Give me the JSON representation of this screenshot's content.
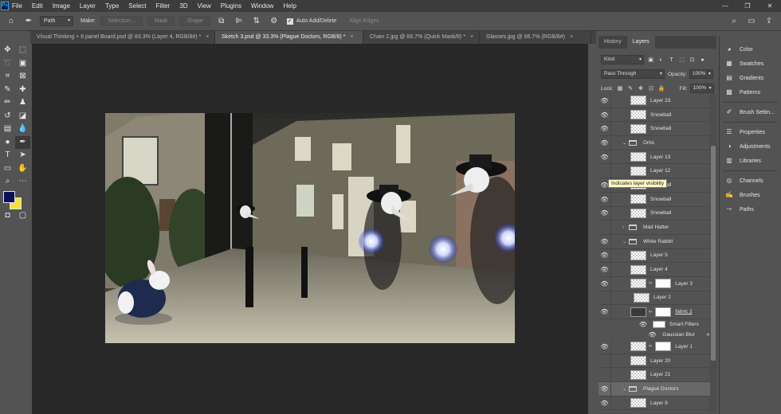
{
  "menu": [
    "File",
    "Edit",
    "Image",
    "Layer",
    "Type",
    "Select",
    "Filter",
    "3D",
    "View",
    "Plugins",
    "Window",
    "Help"
  ],
  "logo": "Ps",
  "window_controls": [
    "—",
    "❐",
    "✕"
  ],
  "options_bar": {
    "mode": "Path",
    "make_label": "Make:",
    "selection_btn": "Selection...",
    "mask_btn": "Mask",
    "shape_btn": "Shape",
    "auto_add_delete": "Auto Add/Delete",
    "align_edges": "Align Edges"
  },
  "tabs": [
    "Visual Thinking + 6 panel Board.psd @ 83.3% (Layer 4, RGB/8#) *",
    "Sketch 3.psd @ 33.3% (Plague Doctors, RGB/8) *",
    "Chain 2.jpg @ 66.7% (Quick Mask/8) *",
    "Glasses.jpg @ 66.7% (RGB/8#)"
  ],
  "tab_close": "×",
  "colors": {
    "foreground": "#0b1057",
    "background": "#f5e13a"
  },
  "layers_panel": {
    "tabs": [
      "History",
      "Layers"
    ],
    "filter": "Kind",
    "blend_mode": "Pass Through",
    "opacity_label": "Opacity:",
    "opacity": "100%",
    "lock_label": "Lock:",
    "fill_label": "Fill:",
    "fill": "100%",
    "tooltip": "Indicates layer visibility",
    "layers": [
      {
        "name": "Layer 23",
        "type": "layer",
        "visible": true
      },
      {
        "name": "Snowball",
        "type": "layer",
        "visible": true
      },
      {
        "name": "Snowball",
        "type": "layer",
        "visible": true
      },
      {
        "name": "Orbs",
        "type": "group",
        "visible": true
      },
      {
        "name": "Layer 13",
        "type": "layer",
        "visible": true
      },
      {
        "name": "Layer 12",
        "type": "layer",
        "visible": false
      },
      {
        "name": "Snowball",
        "type": "layer",
        "visible": true
      },
      {
        "name": "Snowball",
        "type": "layer",
        "visible": true
      },
      {
        "name": "Snowball",
        "type": "layer",
        "visible": true
      },
      {
        "name": "Mad Hatter",
        "type": "group",
        "visible": false
      },
      {
        "name": "White Rabbit",
        "type": "group",
        "visible": true
      },
      {
        "name": "Layer 5",
        "type": "layer",
        "visible": true
      },
      {
        "name": "Layer 4",
        "type": "layer",
        "visible": true
      },
      {
        "name": "Layer 3",
        "type": "masked",
        "visible": true
      },
      {
        "name": "Layer 2",
        "type": "layer",
        "visible": true
      },
      {
        "name": "fabric 2",
        "type": "masked",
        "visible": true
      },
      {
        "name": "Smart Filters",
        "type": "sub",
        "visible": true
      },
      {
        "name": "Gaussian Blur",
        "type": "sub",
        "visible": true
      },
      {
        "name": "Layer 1",
        "type": "masked",
        "visible": true
      },
      {
        "name": "Layer 20",
        "type": "layer",
        "visible": false
      },
      {
        "name": "Layer 21",
        "type": "layer",
        "visible": false
      },
      {
        "name": "Plague Doctors",
        "type": "group",
        "visible": true,
        "selected": true
      },
      {
        "name": "Layer 9",
        "type": "layer",
        "visible": true
      }
    ]
  },
  "dock": [
    {
      "label": "Color",
      "icon": "color-icon"
    },
    {
      "label": "Swatches",
      "icon": "swatches-icon"
    },
    {
      "label": "Gradients",
      "icon": "gradients-icon"
    },
    {
      "label": "Patterns",
      "icon": "patterns-icon"
    },
    {
      "label": "Brush Settin...",
      "icon": "brush-settings-icon"
    },
    {
      "label": "Properties",
      "icon": "properties-icon"
    },
    {
      "label": "Adjustments",
      "icon": "adjustments-icon"
    },
    {
      "label": "Libraries",
      "icon": "libraries-icon"
    },
    {
      "label": "Channels",
      "icon": "channels-icon"
    },
    {
      "label": "Brushes",
      "icon": "brushes-icon"
    },
    {
      "label": "Paths",
      "icon": "paths-icon"
    }
  ]
}
